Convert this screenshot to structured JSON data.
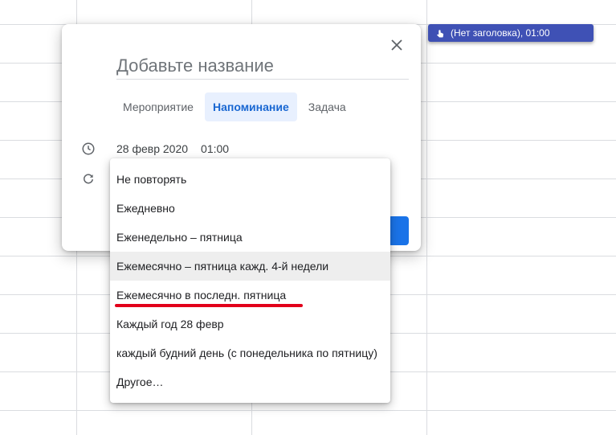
{
  "calendar_event": {
    "label": "(Нет заголовка), 01:00",
    "color": "#3f51b5"
  },
  "dialog": {
    "title_placeholder": "Добавьте название",
    "tabs": [
      {
        "label": "Мероприятие",
        "active": false
      },
      {
        "label": "Напоминание",
        "active": true
      },
      {
        "label": "Задача",
        "active": false
      }
    ],
    "date": "28 февр 2020",
    "time": "01:00",
    "save_color": "#1a73e8"
  },
  "repeat_menu": {
    "options": [
      "Не повторять",
      "Ежедневно",
      "Еженедельно – пятница",
      "Ежемесячно – пятница кажд. 4-й недели",
      "Ежемесячно в последн. пятница",
      "Каждый год 28 февр",
      "каждый будний день (с понедельника по пятницу)",
      "Другое…"
    ],
    "hovered_index": 3,
    "underlined_index": 4,
    "underline_color": "#e2001a"
  },
  "icons": {
    "close": "close-icon",
    "clock": "clock-icon",
    "repeat": "repeat-icon",
    "event": "touch-icon"
  }
}
